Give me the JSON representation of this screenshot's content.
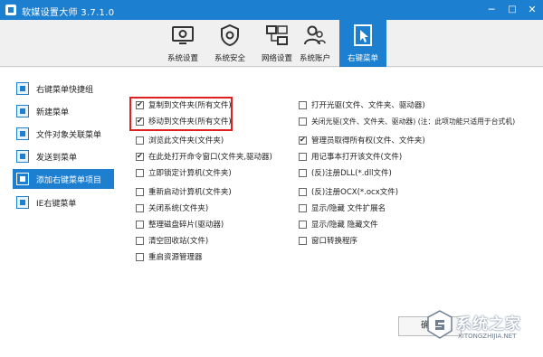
{
  "window": {
    "title": "软媒设置大师 3.7.1.0",
    "minimize": "─",
    "maximize": "□",
    "close": "✕"
  },
  "toolbar": {
    "items": [
      {
        "label": "系统设置",
        "icon": "system-settings-icon"
      },
      {
        "label": "系统安全",
        "icon": "shield-gear-icon"
      },
      {
        "label": "网络设置",
        "icon": "network-icon"
      },
      {
        "label": "系统账户",
        "icon": "users-icon"
      },
      {
        "label": "右键菜单",
        "icon": "cursor-icon",
        "active": true
      }
    ]
  },
  "sidebar": {
    "items": [
      {
        "label": "右键菜单快捷组"
      },
      {
        "label": "新建菜单"
      },
      {
        "label": "文件对象关联菜单"
      },
      {
        "label": "发送到菜单"
      },
      {
        "label": "添加右键菜单项目",
        "active": true
      },
      {
        "label": "IE右键菜单"
      }
    ]
  },
  "options": {
    "left": [
      {
        "label": "复制到文件夹(所有文件)",
        "checked": true
      },
      {
        "label": "移动到文件夹(所有文件)",
        "checked": true
      },
      {
        "label": "浏览此文件夹(文件夹)",
        "checked": false
      },
      {
        "label": "在此处打开命令窗口(文件夹,驱动器)",
        "checked": true
      },
      {
        "label": "立即锁定计算机(文件夹)",
        "checked": false
      },
      {
        "label": "重新启动计算机(文件夹)",
        "checked": false
      },
      {
        "label": "关闭系统(文件夹)",
        "checked": false
      },
      {
        "label": "整理磁盘碎片(驱动器)",
        "checked": false
      },
      {
        "label": "清空回收站(文件)",
        "checked": false
      },
      {
        "label": "重启资源管理器",
        "checked": false
      }
    ],
    "right": [
      {
        "label": "打开光驱(文件、文件夹、驱动器)",
        "checked": false
      },
      {
        "label": "关闭光驱(文件、文件夹、驱动器) (注：此项功能只适用于台式机)",
        "checked": false
      },
      {
        "label": "管理员取得所有权(文件、文件夹)",
        "checked": true
      },
      {
        "label": "用记事本打开该文件(文件)",
        "checked": false
      },
      {
        "label": "(反)注册DLL(*.dll文件)",
        "checked": false
      },
      {
        "label": "(反)注册OCX(*.ocx文件)",
        "checked": false
      },
      {
        "label": "显示/隐藏 文件扩展名",
        "checked": false
      },
      {
        "label": "显示/隐藏 隐藏文件",
        "checked": false
      },
      {
        "label": "窗口转换程序",
        "checked": false
      }
    ]
  },
  "ok_button": "确定",
  "watermark": {
    "text": "系统之家",
    "url": "XITONGZHIJIA.NET"
  },
  "colors": {
    "accent": "#1c7fd0",
    "highlight_border": "#e02020"
  }
}
